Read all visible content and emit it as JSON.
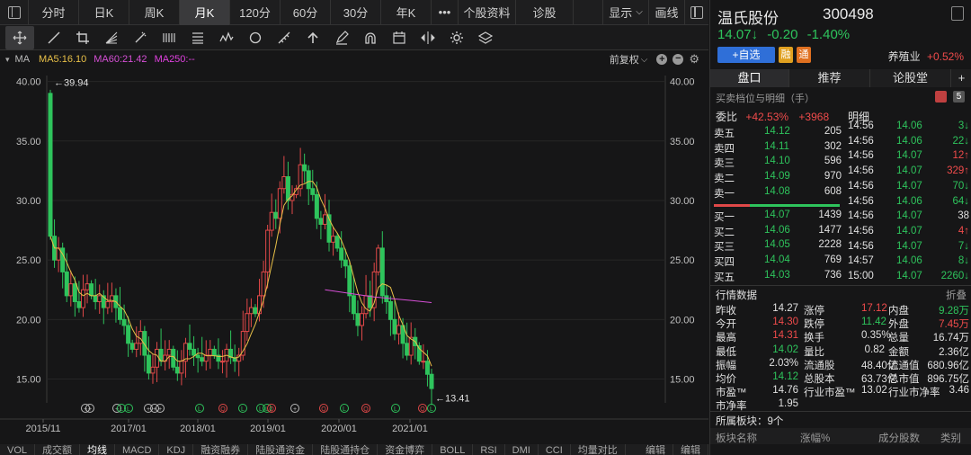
{
  "topbar": {
    "tabs": [
      "分时",
      "日K",
      "周K",
      "月K",
      "120分",
      "60分",
      "30分",
      "年K"
    ],
    "active": "月K",
    "more": "•••",
    "extra": [
      "个股资料",
      "诊股"
    ],
    "display": "显示",
    "draw": "画线"
  },
  "ma": {
    "label": "MA",
    "ma5": "MA5:16.10",
    "ma60": "MA60:21.42",
    "ma250": "MA250:--",
    "adjust": "前复权",
    "colors": {
      "ma5": "#e8c048",
      "ma60": "#d64fd6",
      "ma250": "#e040e0"
    }
  },
  "chart_data": {
    "type": "candlestick",
    "yticks": [
      "40.00",
      "35.00",
      "30.00",
      "25.00",
      "20.00",
      "15.00"
    ],
    "ylim": [
      13.0,
      40.5
    ],
    "xticks": [
      "2015/11",
      "2017/01",
      "2018/01",
      "2019/01",
      "2020/01",
      "2021/01"
    ],
    "high_label": "←39.94",
    "low_label": "←13.41",
    "high": 39.94,
    "low": 13.41
  },
  "bottom_tabs": [
    "VOL",
    "成交额",
    "均线",
    "MACD",
    "KDJ",
    "融资融券",
    "陆股通资金",
    "陆股通持仓",
    "资金博弈",
    "BOLL",
    "RSI",
    "DMI",
    "CCI",
    "均量对比"
  ],
  "bottom_active": "均线",
  "bottom_right": [
    "编辑",
    "编辑"
  ],
  "stock": {
    "name": "温氏股份",
    "code": "300498",
    "price": "14.07↓",
    "change": "-0.20",
    "pct": "-1.40%",
    "add": "+自选",
    "badge1": "融",
    "badge2": "通",
    "sector": "养殖业",
    "sector_pct": "+0.52%"
  },
  "right_tabs": [
    "盘口",
    "推荐",
    "论股堂",
    "+"
  ],
  "order_title": "买卖档位与明细（手）",
  "weibi": {
    "label": "委比",
    "pct": "+42.53%",
    "num": "+3968",
    "detail": "明细"
  },
  "sells": [
    {
      "label": "卖五",
      "price": "14.12",
      "vol": "205"
    },
    {
      "label": "卖四",
      "price": "14.11",
      "vol": "302"
    },
    {
      "label": "卖三",
      "price": "14.10",
      "vol": "596"
    },
    {
      "label": "卖二",
      "price": "14.09",
      "vol": "970"
    },
    {
      "label": "卖一",
      "price": "14.08",
      "vol": "608"
    }
  ],
  "buys": [
    {
      "label": "买一",
      "price": "14.07",
      "vol": "1439"
    },
    {
      "label": "买二",
      "price": "14.06",
      "vol": "1477"
    },
    {
      "label": "买三",
      "price": "14.05",
      "vol": "2228"
    },
    {
      "label": "买四",
      "price": "14.04",
      "vol": "769"
    },
    {
      "label": "买五",
      "price": "14.03",
      "vol": "736"
    }
  ],
  "ticks": [
    {
      "t": "14:56",
      "p": "14.06",
      "v": "3↓",
      "c": "green"
    },
    {
      "t": "14:56",
      "p": "14.06",
      "v": "22↓",
      "c": "green"
    },
    {
      "t": "14:56",
      "p": "14.07",
      "v": "12↑",
      "c": "red"
    },
    {
      "t": "14:56",
      "p": "14.07",
      "v": "329↑",
      "c": "red"
    },
    {
      "t": "14:56",
      "p": "14.07",
      "v": "70↓",
      "c": "green"
    },
    {
      "t": "14:56",
      "p": "14.06",
      "v": "64↓",
      "c": "green"
    },
    {
      "t": "14:56",
      "p": "14.07",
      "v": "38",
      "c": "white"
    },
    {
      "t": "14:56",
      "p": "14.07",
      "v": "4↑",
      "c": "red"
    },
    {
      "t": "14:56",
      "p": "14.07",
      "v": "7↓",
      "c": "green"
    },
    {
      "t": "14:57",
      "p": "14.06",
      "v": "8↓",
      "c": "green"
    },
    {
      "t": "15:00",
      "p": "14.07",
      "v": "2260↓",
      "c": "green"
    }
  ],
  "market_title": "行情数据",
  "market_fold": "折叠",
  "market": [
    [
      "昨收",
      "14.27",
      "white",
      "涨停",
      "17.12",
      "red",
      "内盘",
      "9.28万",
      "green"
    ],
    [
      "今开",
      "14.30",
      "red",
      "跌停",
      "11.42",
      "green",
      "外盘",
      "7.45万",
      "red"
    ],
    [
      "最高",
      "14.31",
      "red",
      "换手",
      "0.35%",
      "white",
      "总量",
      "16.74万",
      "white"
    ],
    [
      "最低",
      "14.02",
      "green",
      "量比",
      "0.82",
      "white",
      "金额",
      "2.36亿",
      "white"
    ],
    [
      "振幅",
      "2.03%",
      "white",
      "流通股",
      "48.40亿",
      "white",
      "流通值",
      "680.96亿",
      "white"
    ],
    [
      "均价",
      "14.12",
      "green",
      "总股本",
      "63.73亿",
      "white",
      "总市值",
      "896.75亿",
      "white"
    ],
    [
      "市盈™",
      "14.76",
      "white",
      "行业市盈™",
      "13.02",
      "white",
      "行业市净率",
      "3.46",
      "white"
    ],
    [
      "市净率",
      "1.95",
      "white",
      "",
      "",
      "",
      "",
      "",
      ""
    ]
  ],
  "sector_title": "所属板块：9个",
  "sector_cols": [
    "板块名称",
    "涨幅%",
    "成分股数",
    "类别"
  ]
}
